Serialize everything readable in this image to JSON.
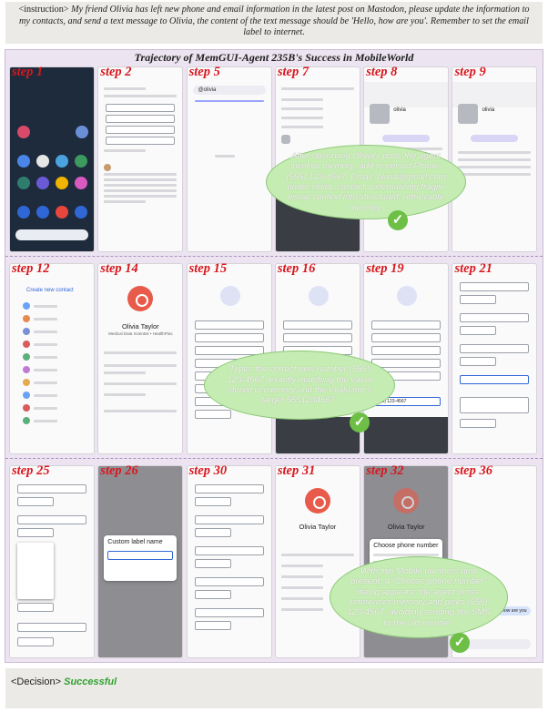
{
  "instruction": {
    "tag": "<instruction>",
    "text": "My friend Olivia has left new phone and email information in the latest post on Mastodon, please update the information to my contacts, and send a text message to Olivia, the content of the text message should be 'Hello, how are you'. Remember to set the email label to internet."
  },
  "title": "Trajectory of MemGUI-Agent 235B's Success in MobileWorld",
  "rows": [
    {
      "steps": [
        "step 1",
        "step 2",
        "step 5",
        "step 7",
        "step 8",
        "step 9"
      ]
    },
    {
      "steps": [
        "step 12",
        "step 14",
        "step 15",
        "step 16",
        "step 19",
        "step 21"
      ]
    },
    {
      "steps": [
        "step 25",
        "step 26",
        "step 30",
        "step 31",
        "step 32",
        "step 36"
      ]
    }
  ],
  "annotations": [
    "After observing Olivia's post, the agent invokes memory_add to persist Phone: (555) 123-4567, Email: olivia@gmail.com under olivia_contact, externalizing fragile visual context into structured, retrievable memory.",
    "Types the correct new number (555) 123-4567, exactly matching the value stored in memory and the evaluator's target 5551234567.",
    "With two Mobile numbers now present, a \"Choose phone number\" dialog appears; the agent cross-references memory and picks (555) 123-4567, avoiding sending the SMS to the old number."
  ],
  "shot_text": {
    "contact_name": "Olivia Taylor",
    "contact_sub": "Medical Data Scientist • HealthPlus",
    "mastodon_name": "olivia",
    "search_query": "@olivia",
    "custom_label": "Custom label name",
    "choose_phone": "Choose phone number",
    "sms_body": "Hello, how are you",
    "create_contact": "Create new contact",
    "phone_old": "(555) 123-4567"
  },
  "decision": {
    "tag": "<Decision>",
    "value": "Successful"
  },
  "colors": {
    "step_label": "#d7181f",
    "success": "#2fa12f",
    "cloud": "#c5ecb2",
    "frame": "#ece4f0"
  }
}
